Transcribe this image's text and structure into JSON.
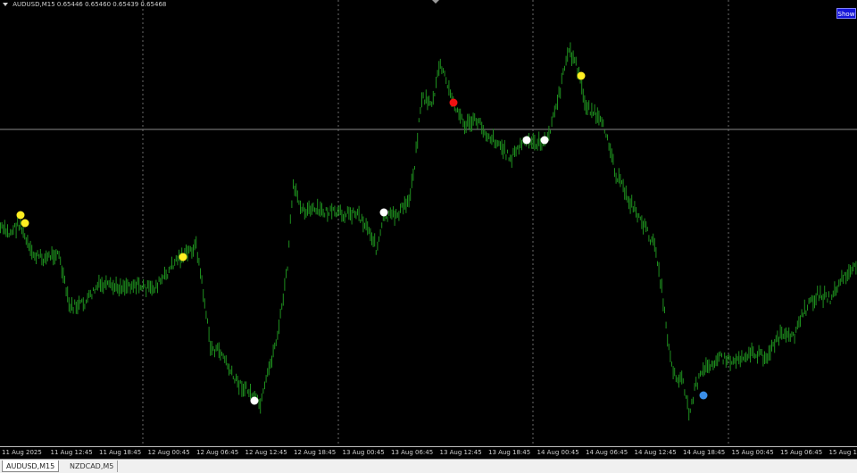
{
  "header": {
    "symbol": "AUDUSD,M15",
    "quote": "0.65446 0.65460 0.65439 0.65468",
    "show_button": "Show"
  },
  "colors": {
    "background": "#000000",
    "bars": "#1e8f1e",
    "grid": "#6a6a6a",
    "crosshair": "#8a8a8a",
    "signal_yellow": "#ffee22",
    "signal_white": "#ffffff",
    "signal_red": "#ee1111",
    "signal_blue": "#3a8ee8"
  },
  "time_axis": {
    "labels": [
      "11 Aug 2025",
      "11 Aug 12:45",
      "11 Aug 18:45",
      "12 Aug 00:45",
      "12 Aug 06:45",
      "12 Aug 12:45",
      "12 Aug 18:45",
      "13 Aug 00:45",
      "13 Aug 06:45",
      "13 Aug 12:45",
      "13 Aug 18:45",
      "14 Aug 00:45",
      "14 Aug 06:45",
      "14 Aug 12:45",
      "14 Aug 18:45",
      "15 Aug 00:45",
      "15 Aug 06:45",
      "15 Aug 1"
    ]
  },
  "tabs": [
    {
      "label": "AUDUSD,M15",
      "active": true
    },
    {
      "label": "NZDCAD,M5",
      "active": false
    }
  ]
}
